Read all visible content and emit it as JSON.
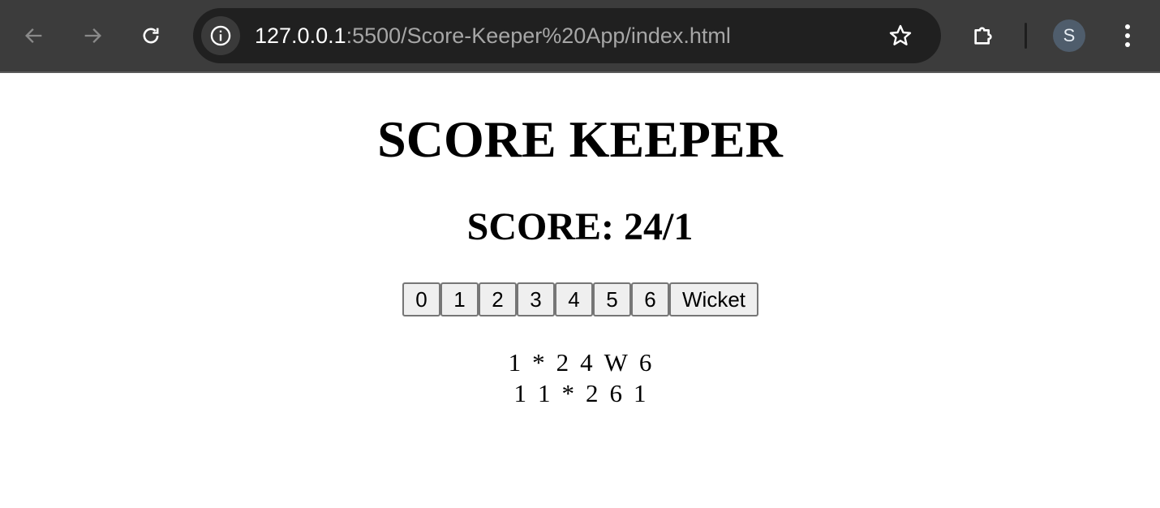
{
  "browser": {
    "url_host": "127.0.0.1",
    "url_path": ":5500/Score-Keeper%20App/index.html",
    "profile_initial": "S"
  },
  "app": {
    "title": "SCORE KEEPER",
    "score_text": "SCORE: 24/1",
    "buttons": [
      "0",
      "1",
      "2",
      "3",
      "4",
      "5",
      "6",
      "Wicket"
    ],
    "overs": [
      [
        "1",
        "*",
        "2",
        "4",
        "W",
        "6"
      ],
      [
        "1",
        "1",
        "*",
        "2",
        "6",
        "1"
      ]
    ]
  }
}
